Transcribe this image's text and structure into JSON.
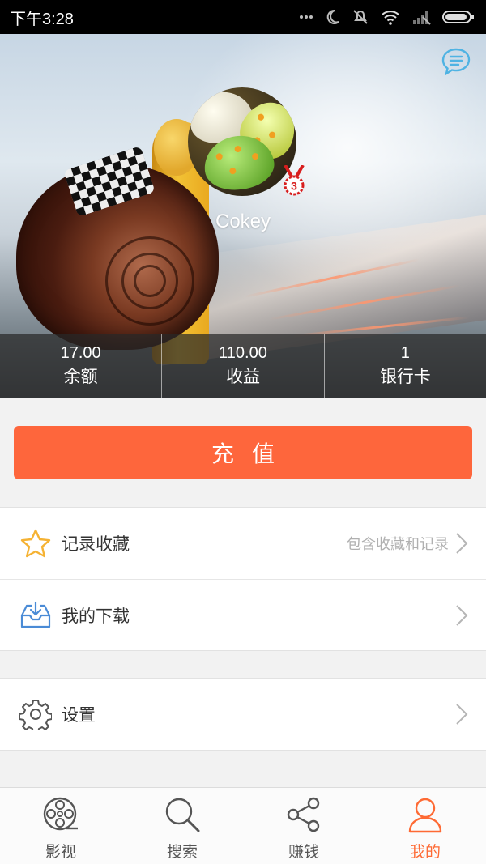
{
  "status_bar": {
    "time": "下午3:28"
  },
  "profile": {
    "username": "Cokey",
    "level_badge": "3",
    "stats": [
      {
        "value": "17.00",
        "label": "余额"
      },
      {
        "value": "110.00",
        "label": "收益"
      },
      {
        "value": "1",
        "label": "银行卡"
      }
    ]
  },
  "recharge": {
    "label": "充值"
  },
  "menu": {
    "records": {
      "label": "记录收藏",
      "hint": "包含收藏和记录"
    },
    "downloads": {
      "label": "我的下载"
    },
    "settings": {
      "label": "设置"
    }
  },
  "bottom_nav": {
    "items": [
      {
        "label": "影视",
        "icon": "film-reel-icon"
      },
      {
        "label": "搜索",
        "icon": "search-icon"
      },
      {
        "label": "赚钱",
        "icon": "share-icon"
      },
      {
        "label": "我的",
        "icon": "user-icon",
        "active": true
      }
    ]
  },
  "colors": {
    "accent": "#fe663c",
    "active_tab": "#fe6a34",
    "star": "#f5b233",
    "download_icon": "#4a8bd6"
  }
}
